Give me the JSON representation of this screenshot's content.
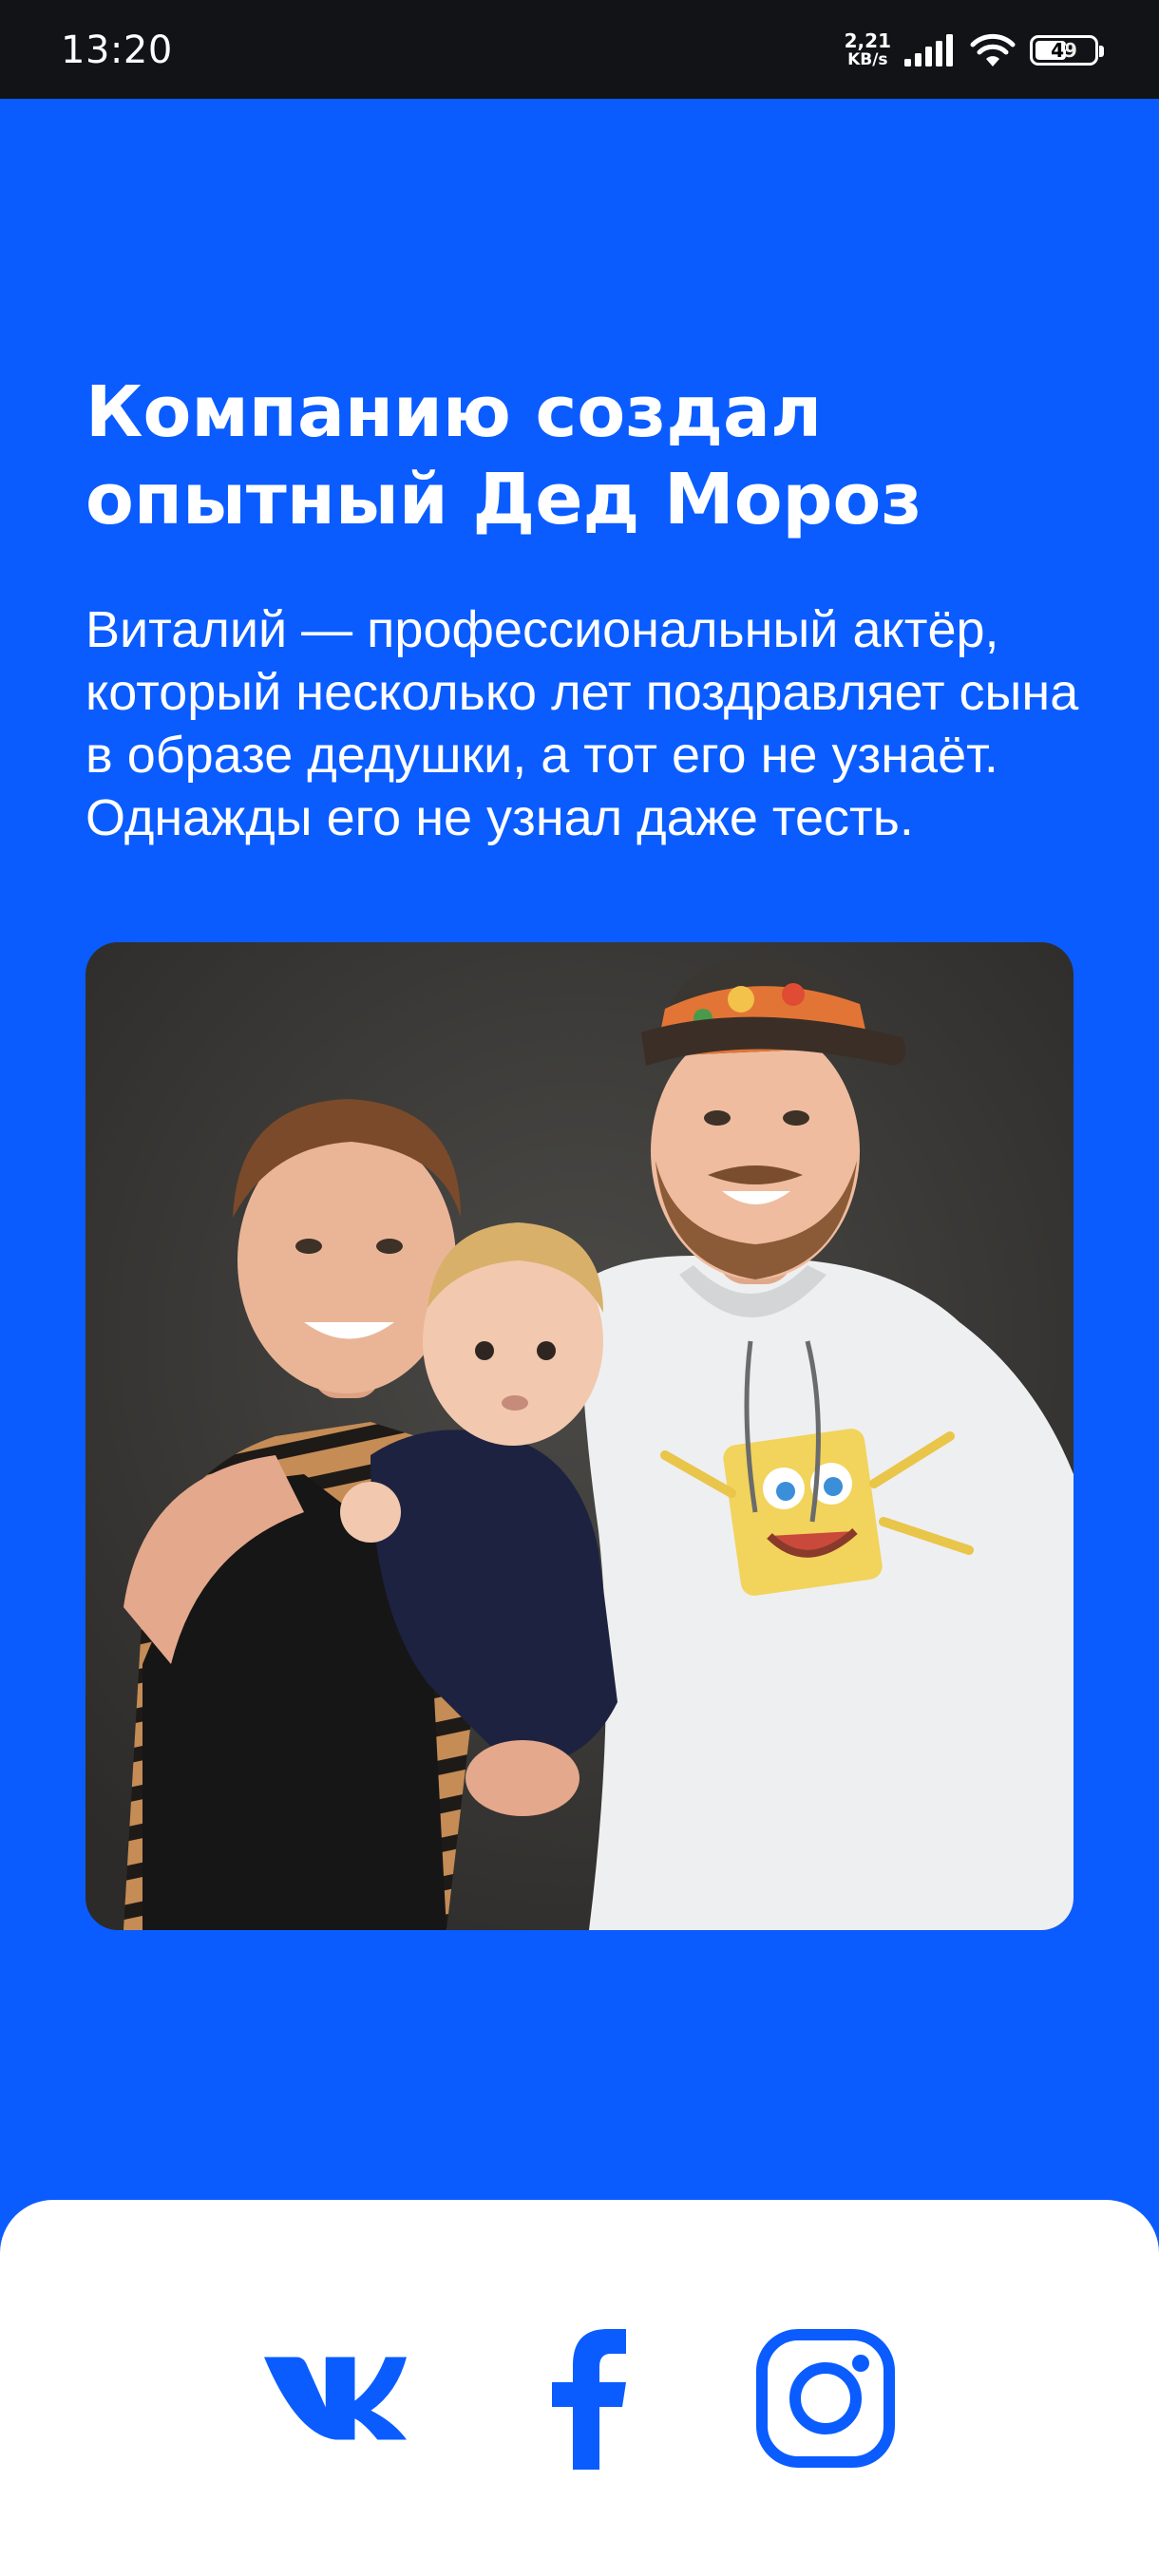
{
  "status_bar": {
    "time": "13:20",
    "net_speed_value": "2,21",
    "net_speed_unit": "KB/s",
    "battery": "49",
    "icons": [
      "signal-icon",
      "wifi-icon",
      "battery-icon"
    ]
  },
  "hero": {
    "title": "Компанию создал опытный Дед Мороз",
    "text": "Виталий — профессиональный актёр, который несколько лет поздравляет сына в образе дедушки, а тот его не узнаёт. Однажды его не узнал даже тесть.",
    "photo_icon": "family-photo"
  },
  "footer": {
    "social": [
      {
        "name": "vk-icon"
      },
      {
        "name": "facebook-icon"
      },
      {
        "name": "instagram-icon"
      }
    ]
  },
  "colors": {
    "brand_blue": "#0A5CFF",
    "status_bar": "#121317",
    "footer_bg": "#FFFFFF"
  }
}
